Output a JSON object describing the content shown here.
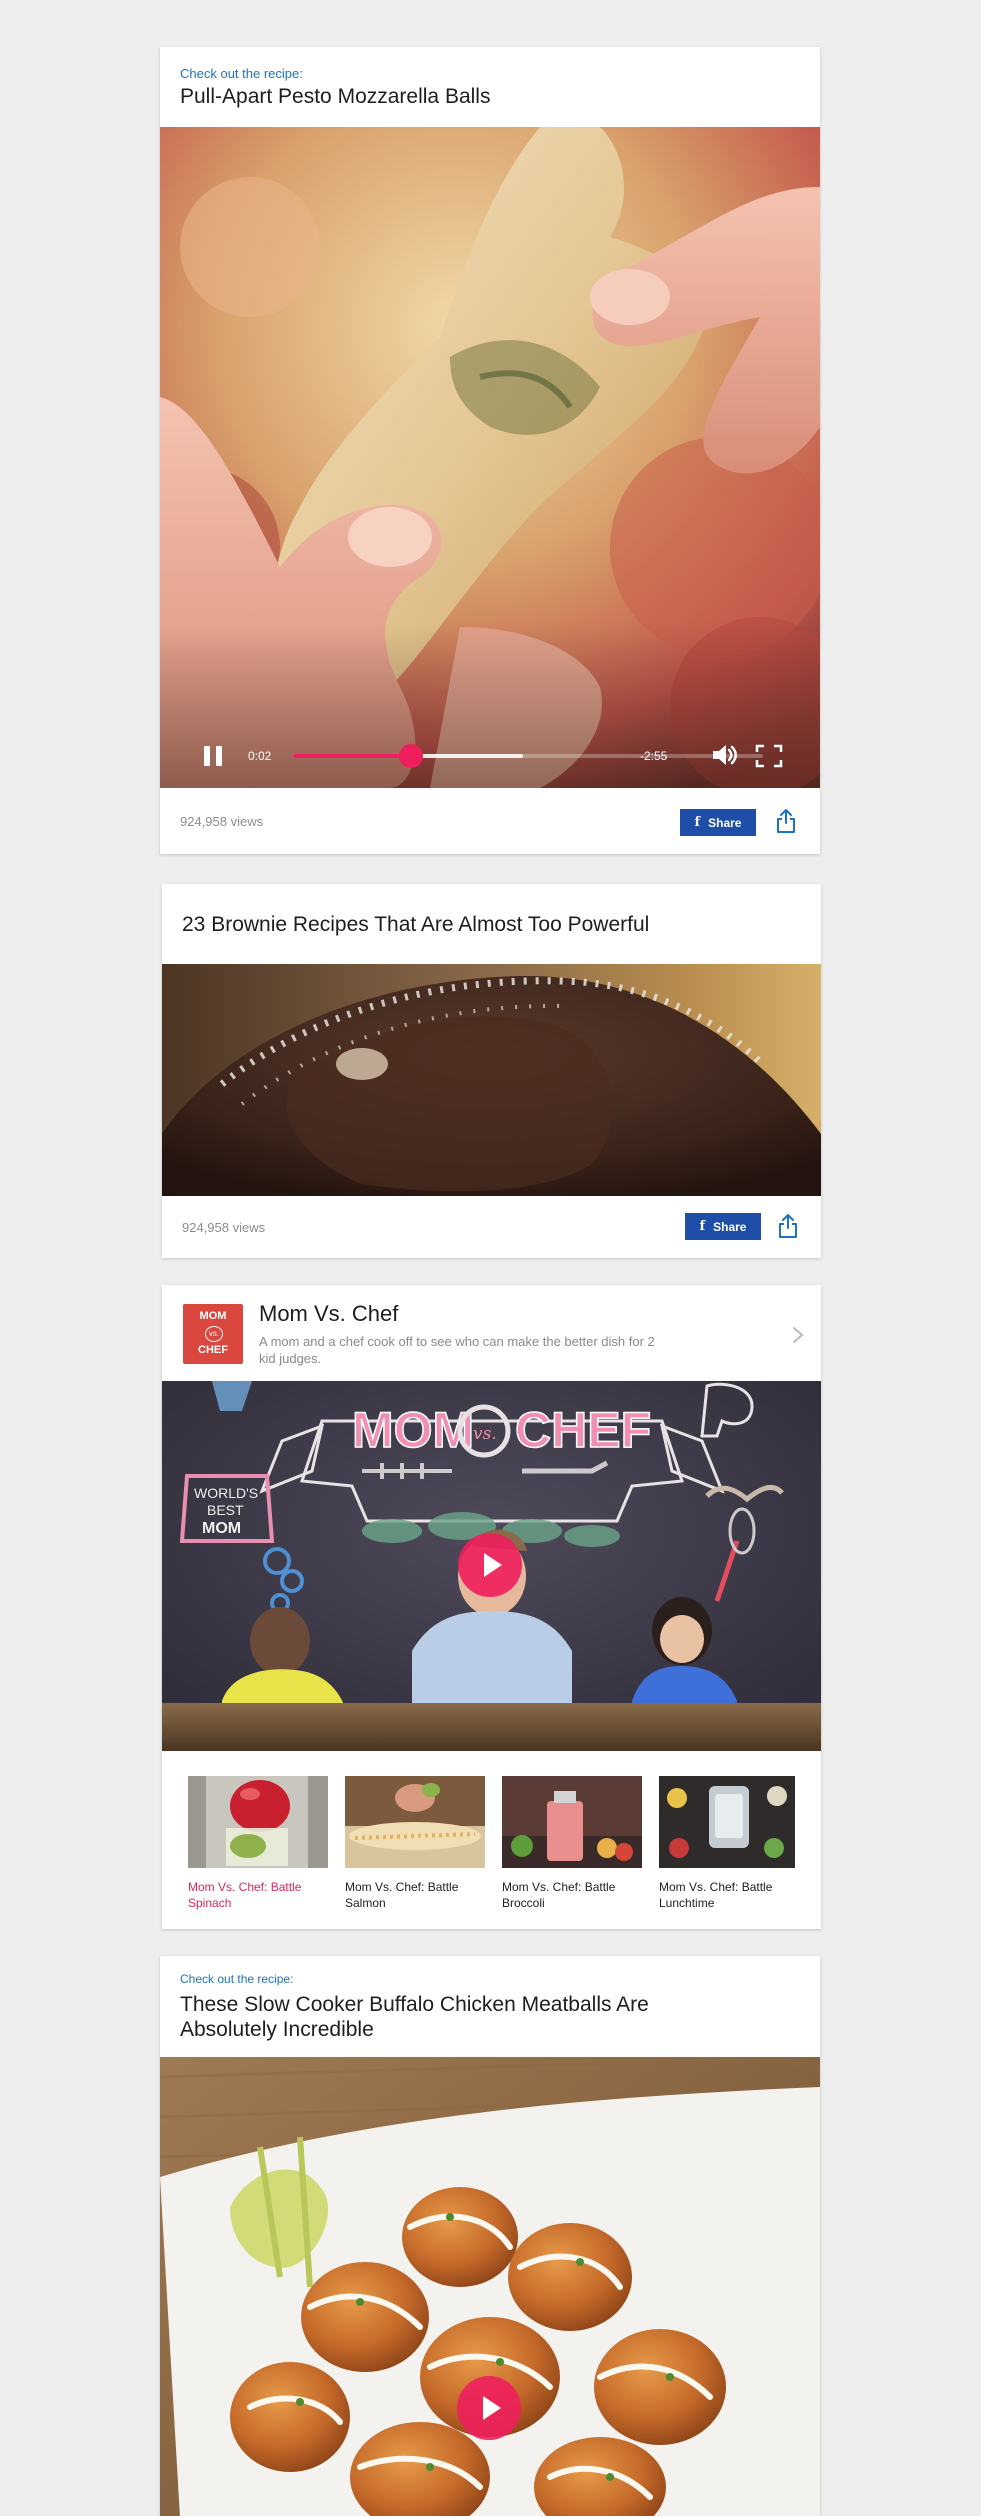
{
  "cards": {
    "pesto": {
      "kicker": "Check out the recipe:",
      "title": "Pull-Apart Pesto Mozzarella Balls",
      "player": {
        "elapsed": "0:02",
        "remaining": "-2:55",
        "progress_fraction": 0.25,
        "buffered_fraction": 0.49
      },
      "views": "924,958 views",
      "share_label": "Share"
    },
    "brownie": {
      "title": "23 Brownie Recipes That Are Almost Too Powerful",
      "views": "924,958 views",
      "share_label": "Share"
    },
    "show": {
      "logo_text_top": "MOM",
      "logo_text_mid": "vs.",
      "logo_text_bottom": "CHEF",
      "name": "Mom Vs. Chef",
      "description": "A mom and a chef cook off to see who can make the better dish for 2 kid judges.",
      "banner": {
        "title_left": "MOM",
        "title_mid": "vs.",
        "title_right": "CHEF",
        "sign_line1": "WORLD'S",
        "sign_line2": "BEST",
        "sign_line3": "MOM"
      },
      "episodes": [
        {
          "caption": "Mom Vs. Chef: Battle Spinach",
          "active": true
        },
        {
          "caption": "Mom Vs. Chef: Battle Salmon",
          "active": false
        },
        {
          "caption": "Mom Vs. Chef: Battle Broccoli",
          "active": false
        },
        {
          "caption": "Mom Vs. Chef: Battle Lunchtime",
          "active": false
        }
      ]
    },
    "meatballs": {
      "kicker": "Check out the recipe:",
      "title": "These Slow Cooker Buffalo Chicken Meatballs Are Absolutely Incredible"
    }
  },
  "colors": {
    "accent_pink": "#ee1f5c",
    "link_blue": "#1a73c9",
    "facebook_blue": "#1f4ea8",
    "page_bg": "#eeeeee"
  },
  "icons": [
    "pause-icon",
    "volume-icon",
    "fullscreen-icon",
    "facebook-icon",
    "share-icon",
    "chevron-right-icon",
    "play-icon"
  ]
}
